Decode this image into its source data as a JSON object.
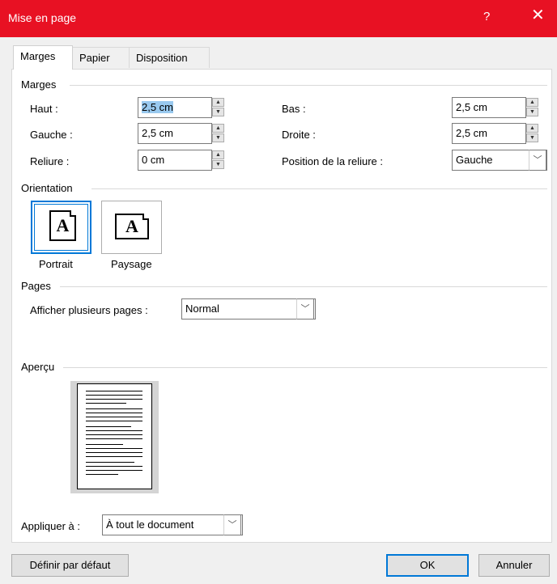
{
  "window": {
    "title": "Mise en page",
    "help_icon": "?",
    "close_icon": "✕"
  },
  "tabs": [
    "Marges",
    "Papier",
    "Disposition"
  ],
  "margins": {
    "group_label": "Marges",
    "haut_label": "Haut :",
    "haut_value": "2,5 cm",
    "bas_label": "Bas :",
    "bas_value": "2,5 cm",
    "gauche_label": "Gauche :",
    "gauche_value": "2,5 cm",
    "droite_label": "Droite :",
    "droite_value": "2,5 cm",
    "reliure_label": "Reliure :",
    "reliure_value": "0 cm",
    "position_label": "Position de la reliure :",
    "position_value": "Gauche"
  },
  "orientation": {
    "group_label": "Orientation",
    "portrait_label": "Portrait",
    "paysage_label": "Paysage",
    "icon_letter": "A"
  },
  "pages": {
    "group_label": "Pages",
    "multiple_label": "Afficher plusieurs pages :",
    "multiple_value": "Normal"
  },
  "preview": {
    "group_label": "Aperçu"
  },
  "apply": {
    "label": "Appliquer à :",
    "value": "À tout le document"
  },
  "buttons": {
    "default": "Définir par défaut",
    "ok": "OK",
    "cancel": "Annuler"
  },
  "colors": {
    "titlebar": "#e81123",
    "focus": "#0078d7",
    "selection": "#99c9ef"
  }
}
